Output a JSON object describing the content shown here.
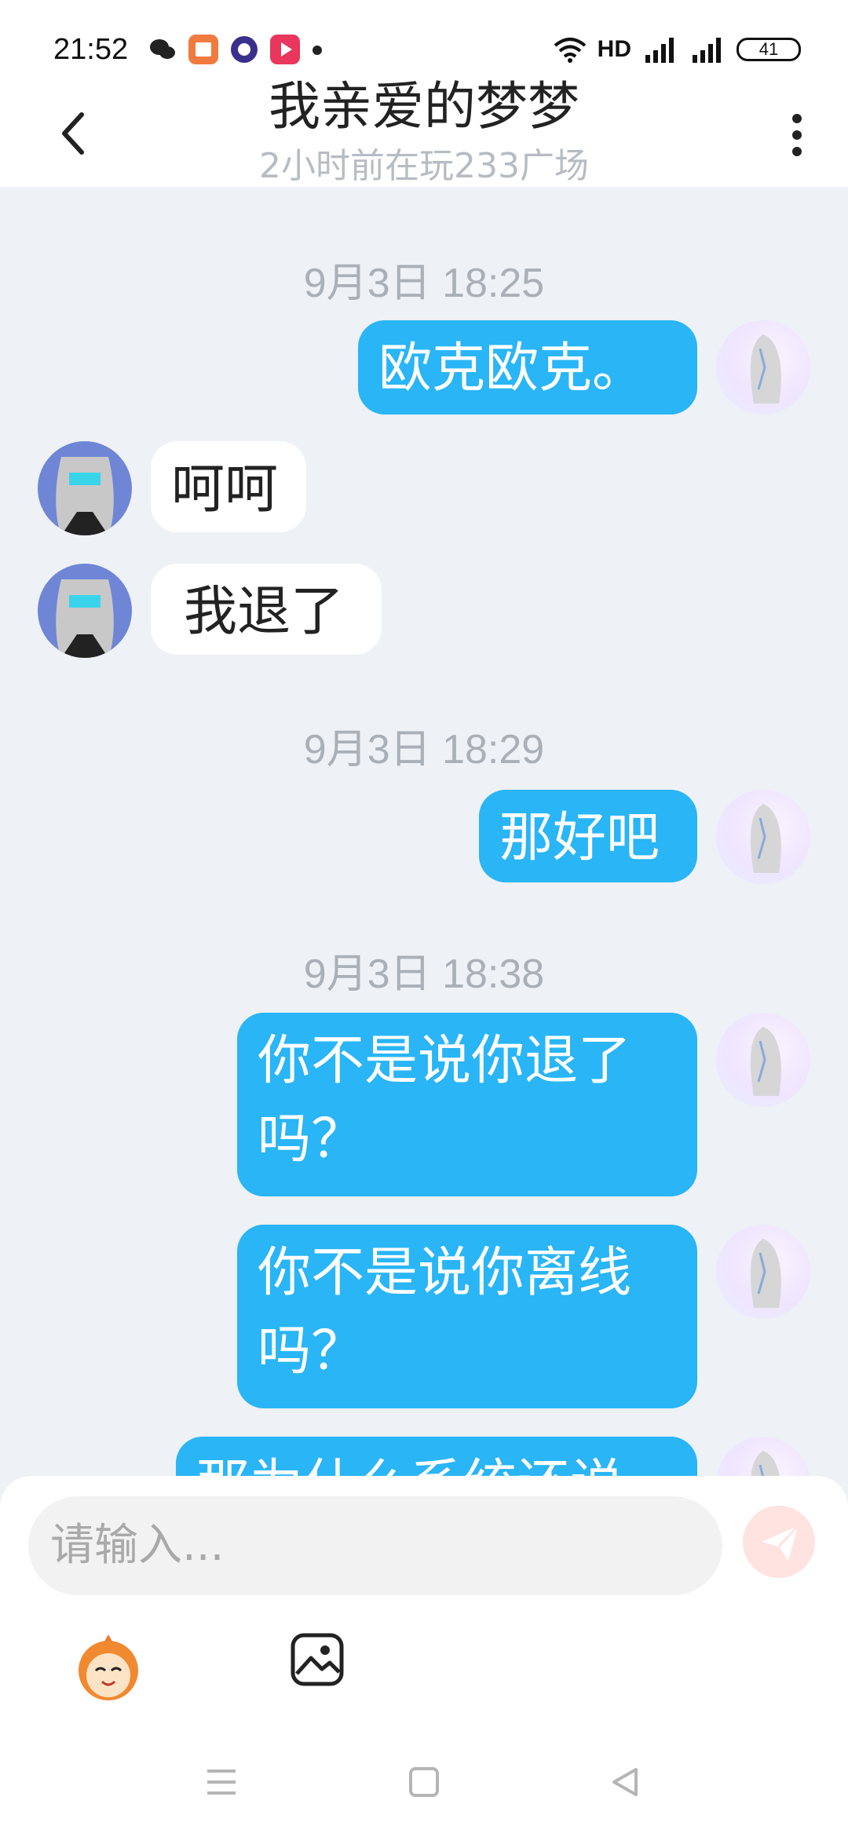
{
  "status_bar": {
    "time": "21:52",
    "network": "HD",
    "battery": "41"
  },
  "header": {
    "title": "我亲爱的梦梦",
    "subtitle": "2小时前在玩233广场"
  },
  "messages": [
    {
      "type": "timestamp",
      "text": "9月3日 18:25"
    },
    {
      "type": "outgoing",
      "text": "欧克欧克。"
    },
    {
      "type": "incoming",
      "text": "呵呵"
    },
    {
      "type": "incoming",
      "text": "我退了"
    },
    {
      "type": "timestamp",
      "text": "9月3日 18:29"
    },
    {
      "type": "outgoing",
      "text": "那好吧"
    },
    {
      "type": "timestamp",
      "text": "9月3日 18:38"
    },
    {
      "type": "outgoing",
      "text": "你不是说你退了吗？"
    },
    {
      "type": "outgoing",
      "text": "你不是说你离线吗？"
    },
    {
      "type": "outgoing",
      "text": "那为什么系统还说"
    }
  ],
  "input": {
    "placeholder": "请输入..."
  },
  "icons": {
    "back": "chevron-left-icon",
    "more": "more-vertical-icon",
    "send": "send-icon",
    "emoji": "emoji-face-icon",
    "image": "image-icon",
    "nav": [
      "menu-icon",
      "home-square-icon",
      "back-triangle-icon"
    ]
  },
  "colors": {
    "outgoing_bubble": "#29b5f6",
    "incoming_bubble": "#ffffff",
    "background": "#eef1f5"
  }
}
